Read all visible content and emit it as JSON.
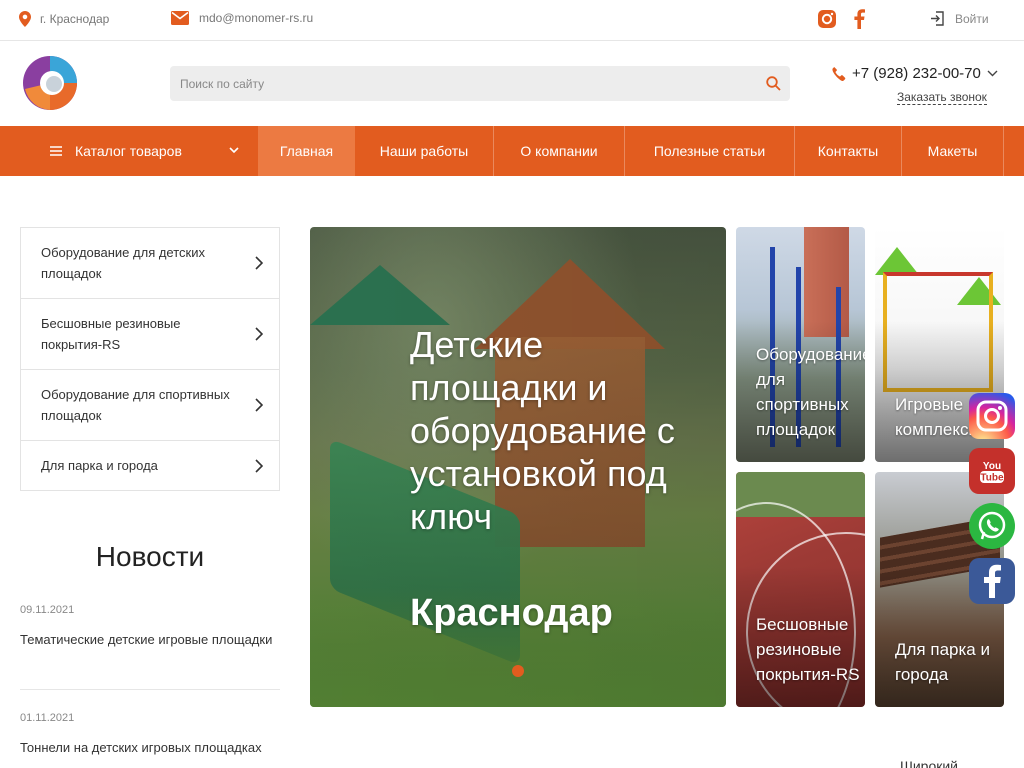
{
  "topbar": {
    "city": "г. Краснодар",
    "email": "mdo@monomer-rs.ru",
    "login": "Войти"
  },
  "header": {
    "search_placeholder": "Поиск по сайту",
    "phone": "+7 (928) 232-00-70",
    "callback": "Заказать звонок"
  },
  "nav": {
    "catalog": "Каталог товаров",
    "items": [
      "Главная",
      "Наши работы",
      "О компании",
      "Полезные статьи",
      "Контакты",
      "Макеты"
    ]
  },
  "sidebar": {
    "items": [
      "Оборудование для детских площадок",
      "Бесшовные резиновые покрытия-RS",
      "Оборудование для спортивных площадок",
      "Для парка и города"
    ]
  },
  "news": {
    "title": "Новости",
    "items": [
      {
        "date": "09.11.2021",
        "text": "Тематические детские игровые площадки"
      },
      {
        "date": "01.11.2021",
        "text": "Тоннели на детских игровых площадках"
      }
    ]
  },
  "hero": {
    "text": "Детские площадки и оборудование с установкой под ключ",
    "city": "Краснодар"
  },
  "tiles": [
    "Оборудование для спортивных площадок",
    "Игровые комплексы",
    "Бесшовные резиновые покрытия-RS",
    "Для парка и города"
  ],
  "footer_peek": "Широкий",
  "colors": {
    "accent": "#e25c1f",
    "nav_active": "#ec7a42"
  }
}
